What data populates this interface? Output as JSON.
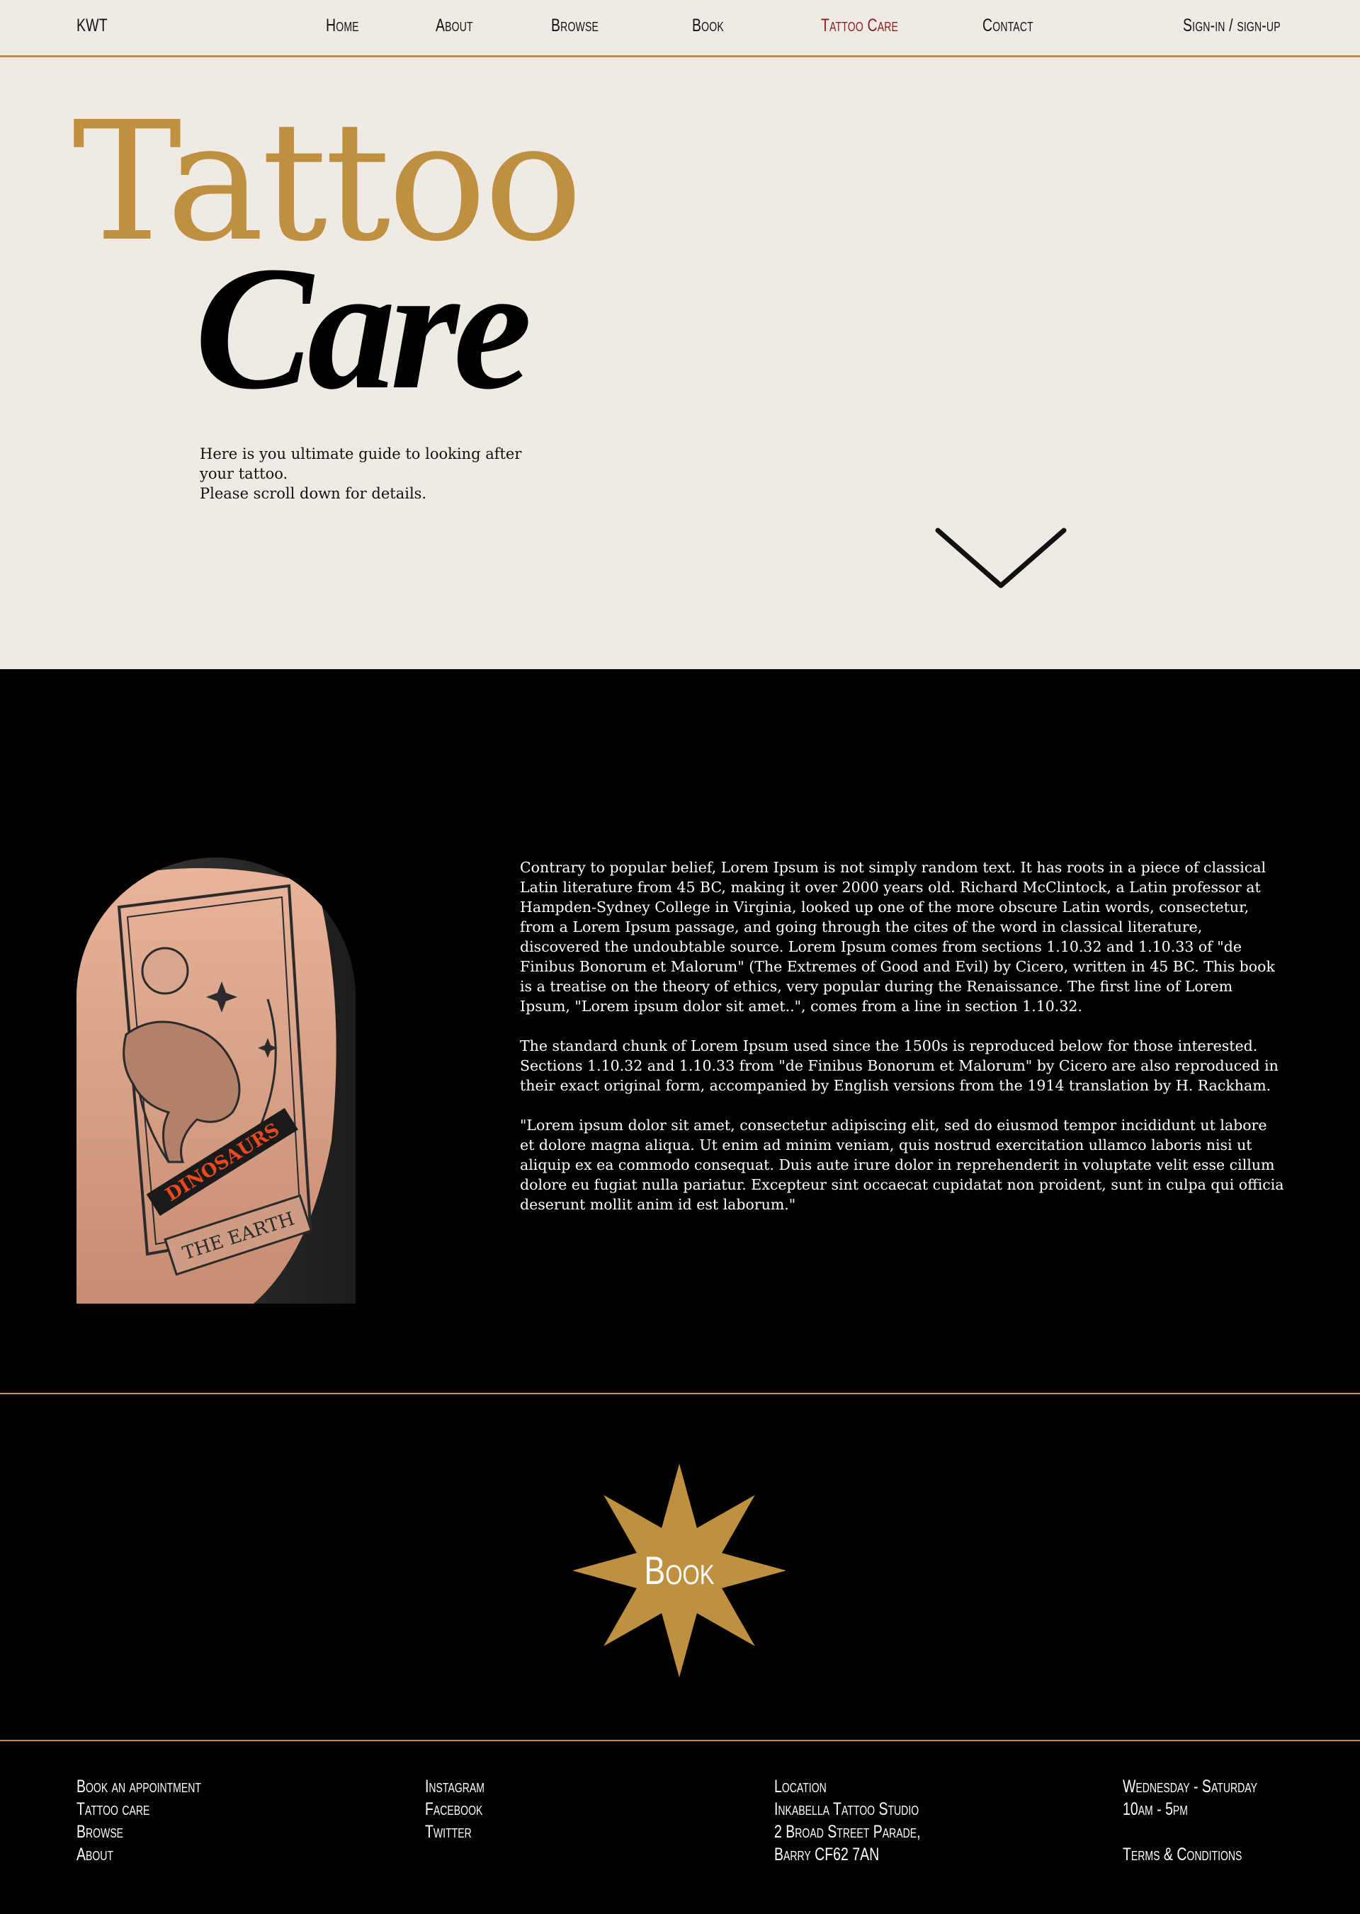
{
  "header": {
    "logo": "KWT",
    "nav": [
      {
        "label": "Home"
      },
      {
        "label": "About"
      },
      {
        "label": "Browse"
      },
      {
        "label": "Book"
      },
      {
        "label": "Tattoo Care"
      },
      {
        "label": "Contact"
      }
    ],
    "signin": "Sign-in / sign-up"
  },
  "hero": {
    "title_line1": "Tattoo",
    "title_line2": "Care",
    "subtitle_1": "Here is you ultimate guide to looking after your tattoo.",
    "subtitle_2": "Please scroll down for details."
  },
  "content": {
    "paragraphs": [
      "Contrary to popular belief, Lorem Ipsum is not simply random text. It has roots in a piece of classical Latin literature from 45 BC, making it over 2000 years old. Richard McClintock, a Latin professor at Hampden-Sydney College in Virginia, looked up one of the more obscure Latin words, consectetur, from a Lorem Ipsum passage, and going through the cites of the word in classical literature, discovered the undoubtable source. Lorem Ipsum comes from sections 1.10.32 and 1.10.33 of \"de Finibus Bonorum et Malorum\" (The Extremes of Good and Evil) by Cicero, written in 45 BC. This book is a treatise on the theory of ethics, very popular during the Renaissance. The first line of Lorem Ipsum, \"Lorem ipsum dolor sit amet..\", comes from a line in section 1.10.32.",
      "The standard chunk of Lorem Ipsum used since the 1500s is reproduced below for those interested. Sections 1.10.32 and 1.10.33 from \"de Finibus Bonorum et Malorum\" by Cicero are also reproduced in their exact original form, accompanied by English versions from the 1914 translation by H. Rackham.",
      "\"Lorem ipsum dolor sit amet, consectetur adipiscing elit, sed do eiusmod tempor incididunt ut labore et dolore magna aliqua. Ut enim ad minim veniam, quis nostrud exercitation ullamco laboris nisi ut aliquip ex ea commodo consequat. Duis aute irure dolor in reprehenderit in voluptate velit esse cillum dolore eu fugiat nulla pariatur. Excepteur sint occaecat cupidatat non proident, sunt in culpa qui officia deserunt mollit anim id est laborum.\""
    ],
    "tattoo_text_1": "DINOSAURS",
    "tattoo_text_2": "THE EARTH"
  },
  "book": {
    "label": "Book"
  },
  "footer": {
    "links": [
      "Book an appointment",
      "Tattoo care",
      "Browse",
      "About"
    ],
    "social": [
      "Instagram",
      "Facebook",
      "Twitter"
    ],
    "location": [
      "Location",
      "Inkabella Tattoo Studio",
      "2 Broad Street Parade,",
      "Barry CF62 7AN"
    ],
    "hours": [
      "Wednesday - Saturday",
      "10am - 5pm"
    ],
    "terms": "Terms & Conditions"
  },
  "colors": {
    "gold": "#bf9040",
    "cream": "#efebe4",
    "active_nav": "#8a1c1c",
    "black": "#000000"
  },
  "icons": {
    "scroll": "chevron-down-icon",
    "book": "star-icon"
  }
}
